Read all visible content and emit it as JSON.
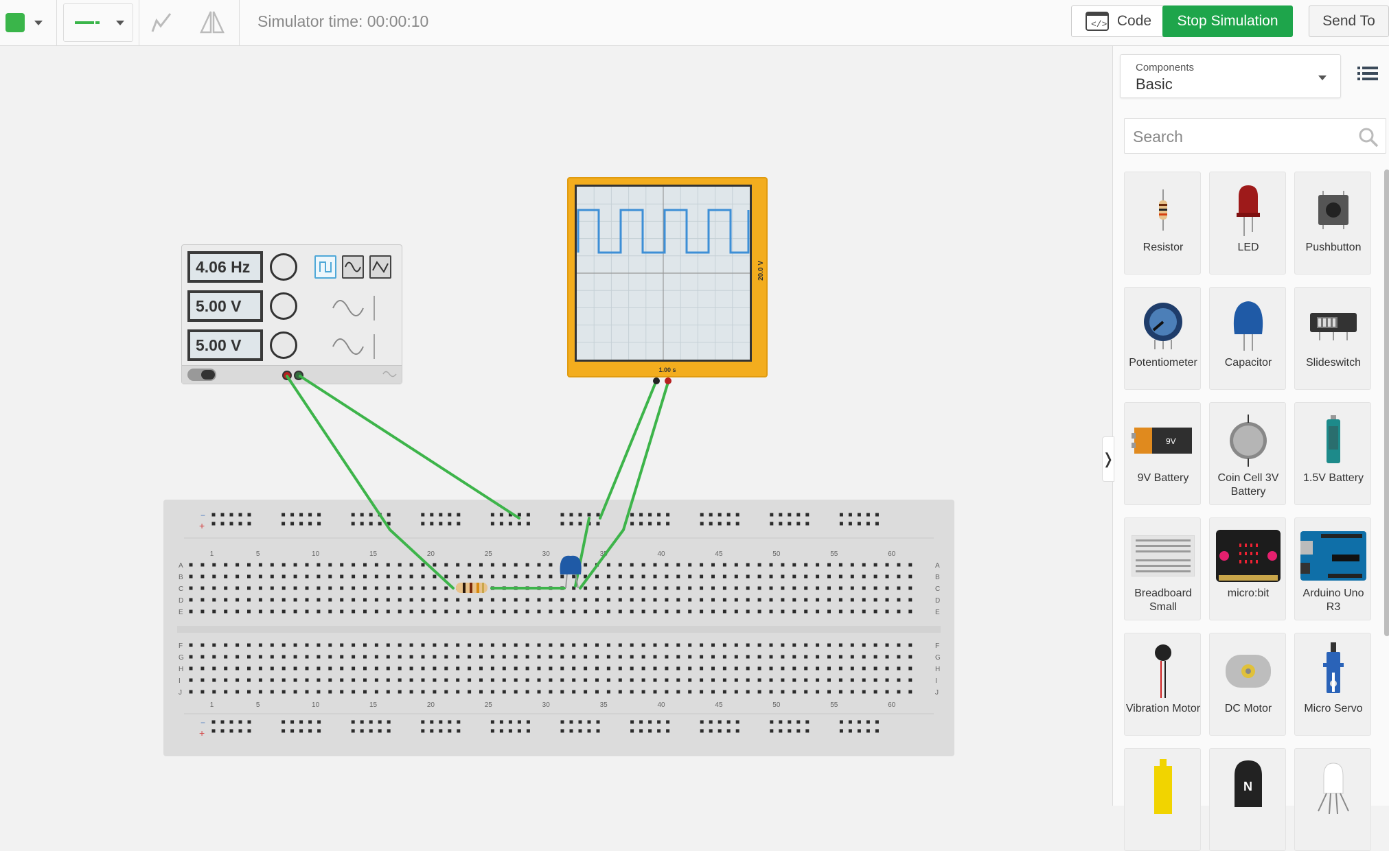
{
  "toolbar": {
    "sim_time": "Simulator time: 00:00:10",
    "code_label": "Code",
    "stop_label": "Stop Simulation",
    "send_label": "Send To",
    "wire_color": "#3ab54a"
  },
  "function_generator": {
    "frequency": "4.06 Hz",
    "amplitude": "5.00 V",
    "offset": "5.00 V"
  },
  "oscilloscope": {
    "x_scale": "1.00 s",
    "y_scale": "20.0 V"
  },
  "breadboard": {
    "col_numbers": [
      "1",
      "5",
      "10",
      "15",
      "20",
      "25",
      "30",
      "35",
      "40",
      "45",
      "50",
      "55",
      "60"
    ],
    "rows_top": [
      "A",
      "B",
      "C",
      "D",
      "E"
    ],
    "rows_bottom": [
      "F",
      "G",
      "H",
      "I",
      "J"
    ]
  },
  "panel": {
    "components_label": "Components",
    "components_value": "Basic",
    "search_placeholder": "Search",
    "items": [
      {
        "name": "Resistor",
        "icon": "resistor-icon"
      },
      {
        "name": "LED",
        "icon": "led-icon"
      },
      {
        "name": "Pushbutton",
        "icon": "pushbutton-icon"
      },
      {
        "name": "Potentiometer",
        "icon": "potentiometer-icon"
      },
      {
        "name": "Capacitor",
        "icon": "capacitor-icon"
      },
      {
        "name": "Slideswitch",
        "icon": "slideswitch-icon"
      },
      {
        "name": "9V Battery",
        "icon": "battery-9v-icon"
      },
      {
        "name": "Coin Cell 3V Battery",
        "icon": "coin-cell-icon"
      },
      {
        "name": "1.5V Battery",
        "icon": "battery-aa-icon"
      },
      {
        "name": "Breadboard Small",
        "icon": "breadboard-icon"
      },
      {
        "name": "micro:bit",
        "icon": "microbit-icon"
      },
      {
        "name": "Arduino Uno R3",
        "icon": "arduino-icon"
      },
      {
        "name": "Vibration Motor",
        "icon": "vibration-motor-icon"
      },
      {
        "name": "DC Motor",
        "icon": "dc-motor-icon"
      },
      {
        "name": "Micro Servo",
        "icon": "micro-servo-icon"
      },
      {
        "name": "",
        "icon": "hobby-gearmotor-icon"
      },
      {
        "name": "",
        "icon": "transistor-icon"
      },
      {
        "name": "",
        "icon": "rgb-led-icon"
      }
    ],
    "transistor_letter": "N"
  }
}
